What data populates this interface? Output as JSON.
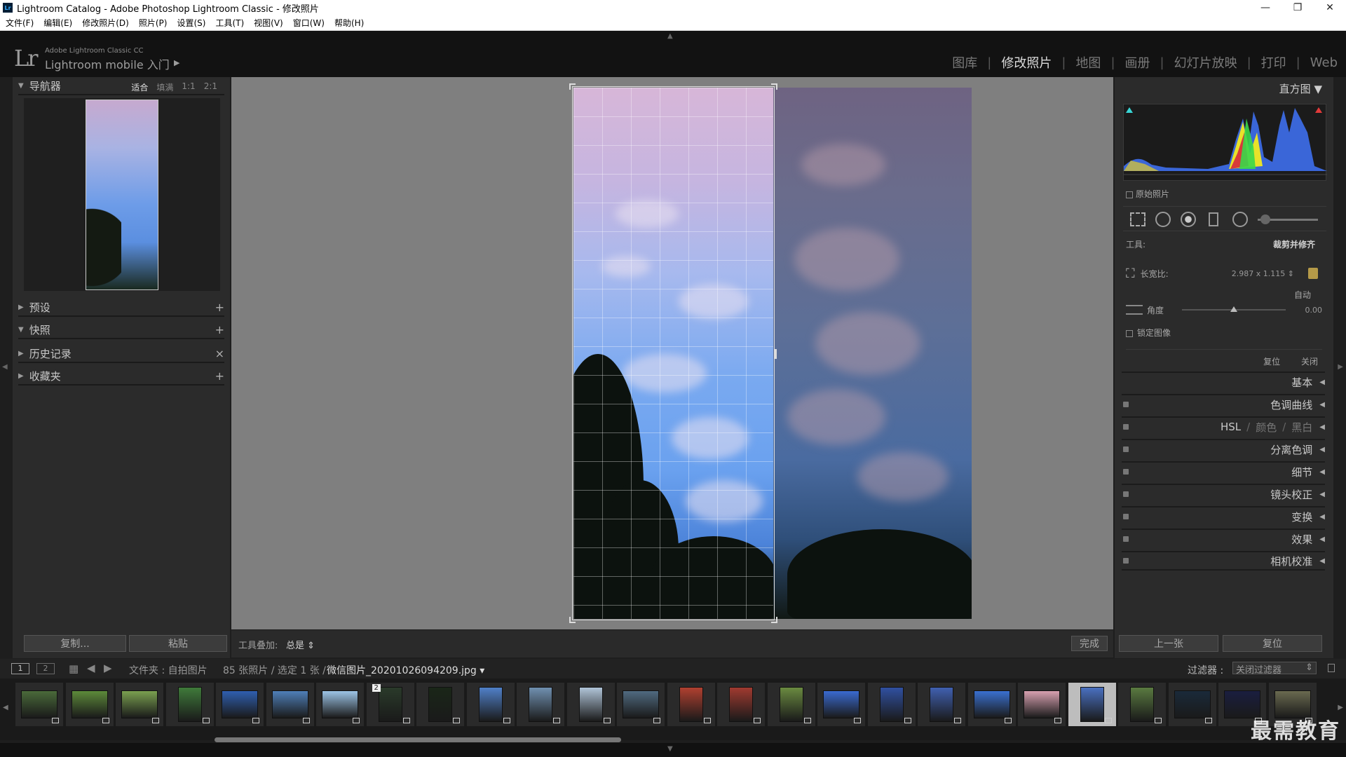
{
  "window": {
    "title": "Lightroom Catalog - Adobe Photoshop Lightroom Classic - 修改照片",
    "minimize": "—",
    "maximize": "❐",
    "close": "✕"
  },
  "menu": [
    "文件(F)",
    "编辑(E)",
    "修改照片(D)",
    "照片(P)",
    "设置(S)",
    "工具(T)",
    "视图(V)",
    "窗口(W)",
    "帮助(H)"
  ],
  "identity": {
    "logo": "Lr",
    "product_line1": "Adobe Lightroom Classic CC",
    "product_line2": "Lightroom mobile 入门",
    "arrow": "▶"
  },
  "modules": [
    "图库",
    "修改照片",
    "地图",
    "画册",
    "幻灯片放映",
    "打印",
    "Web"
  ],
  "active_module": "修改照片",
  "left_panel": {
    "navigator": {
      "title": "导航器",
      "options": [
        "适合",
        "填满",
        "1:1",
        "2:1"
      ],
      "selected": "适合"
    },
    "sections": [
      {
        "title": "预设",
        "action": "+"
      },
      {
        "title": "快照",
        "action": "+"
      },
      {
        "title": "历史记录",
        "action": "×"
      },
      {
        "title": "收藏夹",
        "action": "+"
      }
    ],
    "copy_button": "复制...",
    "paste_button": "粘贴"
  },
  "toolbar": {
    "overlay_label": "工具叠加:",
    "overlay_value": "总是",
    "done_button": "完成"
  },
  "right_panel": {
    "histogram_title": "直方图",
    "original_photo": "原始照片",
    "crop": {
      "tool_label": "工具:",
      "tool_name": "裁剪并修齐",
      "aspect_label": "长宽比:",
      "aspect_value": "2.987 x 1.115",
      "auto_label": "自动",
      "angle_label": "角度",
      "angle_value": "0.00",
      "angle_position": 0.5,
      "lock_image": "锁定图像",
      "reset": "复位",
      "close": "关闭"
    },
    "sections": [
      "基本",
      "色调曲线",
      "分离色调",
      "细节",
      "镜头校正",
      "变换",
      "效果",
      "相机校准"
    ],
    "hsl": {
      "hsl": "HSL",
      "color": "颜色",
      "bw": "黑白",
      "sep": "/"
    },
    "prev_button": "上一张",
    "reset_button": "复位"
  },
  "filmbar": {
    "view1": "1",
    "view2": "2",
    "path": "文件夹 : 自拍图片",
    "count": "85 张照片 / 选定 1 张 /",
    "filename": "微信图片_20201026094209.jpg",
    "filter_label": "过滤器 :",
    "filter_value": "关闭过滤器"
  },
  "filmstrip": {
    "thumb_count": 26,
    "selected_index": 21,
    "stack_number": "2"
  },
  "watermark": "最需教育",
  "colors": {
    "accent_active": "#dcdcdc",
    "panel_bg": "#2b2b2b",
    "canvas_bg": "#7f7f7f"
  }
}
